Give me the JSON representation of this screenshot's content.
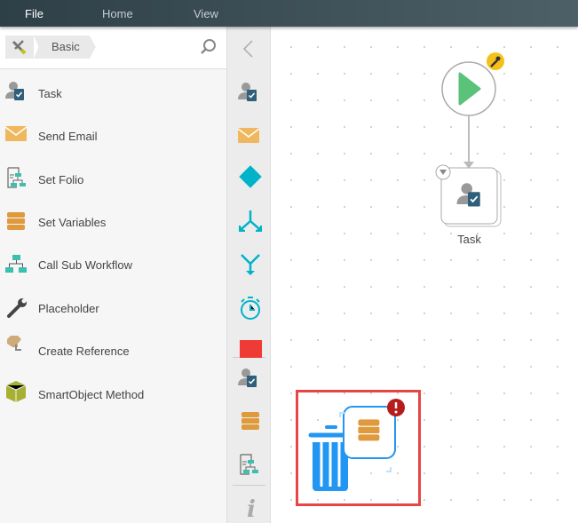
{
  "menu": {
    "file": "File",
    "home": "Home",
    "view": "View"
  },
  "toolbox": {
    "category": "Basic",
    "items": [
      {
        "label": "Task",
        "icon": "task-icon"
      },
      {
        "label": "Send Email",
        "icon": "email-icon"
      },
      {
        "label": "Set Folio",
        "icon": "folio-icon"
      },
      {
        "label": "Set Variables",
        "icon": "variables-icon"
      },
      {
        "label": "Call Sub Workflow",
        "icon": "sub-workflow-icon"
      },
      {
        "label": "Placeholder",
        "icon": "wrench-icon"
      },
      {
        "label": "Create Reference",
        "icon": "reference-icon"
      },
      {
        "label": "SmartObject Method",
        "icon": "smartobject-icon"
      }
    ]
  },
  "canvas": {
    "task_label": "Task"
  },
  "colors": {
    "accent_blue": "#2196f3",
    "teal": "#00b3c9",
    "orange": "#e09a3e",
    "error": "#b71c1c",
    "highlight": "#e84545"
  }
}
